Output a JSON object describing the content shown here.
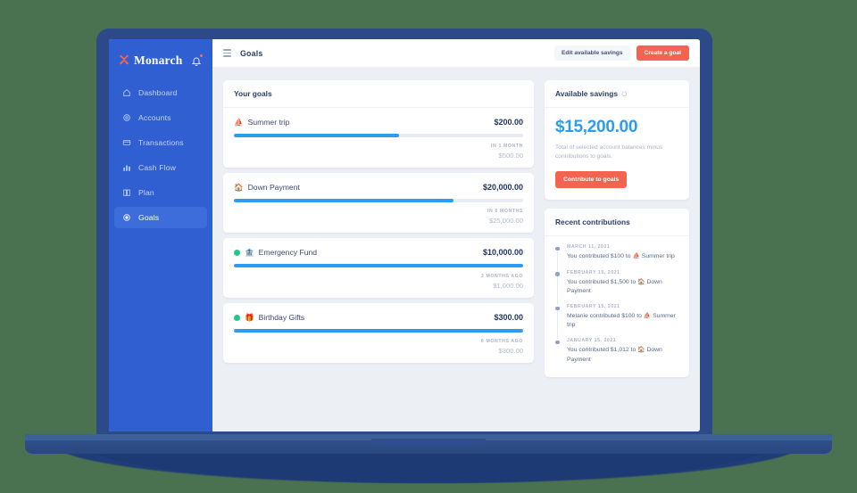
{
  "colors": {
    "background": "#4a7150",
    "laptop": "#2c4a88",
    "sidebar": "#2f5fd0",
    "accent_blue": "#2b9cf0",
    "accent_coral": "#f4634f",
    "done_green": "#25c685"
  },
  "sidebar": {
    "brand": "Monarch",
    "brand_mark_icon": "monarch-butterfly-logo",
    "bell_icon": "notification-bell-icon",
    "items": [
      {
        "label": "Dashboard",
        "icon": "home-icon",
        "active": false
      },
      {
        "label": "Accounts",
        "icon": "accounts-icon",
        "active": false
      },
      {
        "label": "Transactions",
        "icon": "credit-card-icon",
        "active": false
      },
      {
        "label": "Cash Flow",
        "icon": "bar-chart-icon",
        "active": false
      },
      {
        "label": "Plan",
        "icon": "book-icon",
        "active": false
      },
      {
        "label": "Goals",
        "icon": "target-icon",
        "active": true
      }
    ]
  },
  "topbar": {
    "menu_icon": "hamburger-menu-icon",
    "title": "Goals",
    "edit_savings_label": "Edit available savings",
    "create_goal_label": "Create a goal"
  },
  "goals_panel": {
    "title": "Your goals",
    "goals": [
      {
        "emoji": "⛵",
        "emoji_name": "sailboat-emoji",
        "name": "Summer trip",
        "amount": "$200.00",
        "progress": 57,
        "when": "IN 1 MONTH",
        "target": "$500.00",
        "completed": false
      },
      {
        "emoji": "🏠",
        "emoji_name": "house-emoji",
        "name": "Down Payment",
        "amount": "$20,000.00",
        "progress": 76,
        "when": "IN 6 MONTHS",
        "target": "$25,000.00",
        "completed": false
      },
      {
        "emoji": "🏦",
        "emoji_name": "bank-emoji",
        "name": "Emergency Fund",
        "amount": "$10,000.00",
        "progress": 100,
        "when": "2 MONTHS AGO",
        "target": "$1,000.00",
        "completed": true
      },
      {
        "emoji": "🎁",
        "emoji_name": "gift-emoji",
        "name": "Birthday Gifts",
        "amount": "$300.00",
        "progress": 100,
        "when": "6 MONTHS AGO",
        "target": "$300.00",
        "completed": true
      }
    ]
  },
  "savings_panel": {
    "title": "Available savings",
    "info_icon": "info-circle-icon",
    "amount": "$15,200.00",
    "description": "Total of selected account balances minus contributions to goals.",
    "contribute_label": "Contribute to goals"
  },
  "contributions_panel": {
    "title": "Recent contributions",
    "items": [
      {
        "date": "MARCH 11, 2021",
        "text": "You contributed $100 to ⛵ Summer trip"
      },
      {
        "date": "FEBRUARY 15, 2021",
        "text": "You contributed $1,500 to 🏠 Down Payment"
      },
      {
        "date": "FEBRUARY 15, 2021",
        "text": "Melanie contributed $100 to ⛵ Summer trip"
      },
      {
        "date": "JANUARY 15, 2021",
        "text": "You contributed $1,012 to 🏠 Down Payment"
      }
    ]
  }
}
